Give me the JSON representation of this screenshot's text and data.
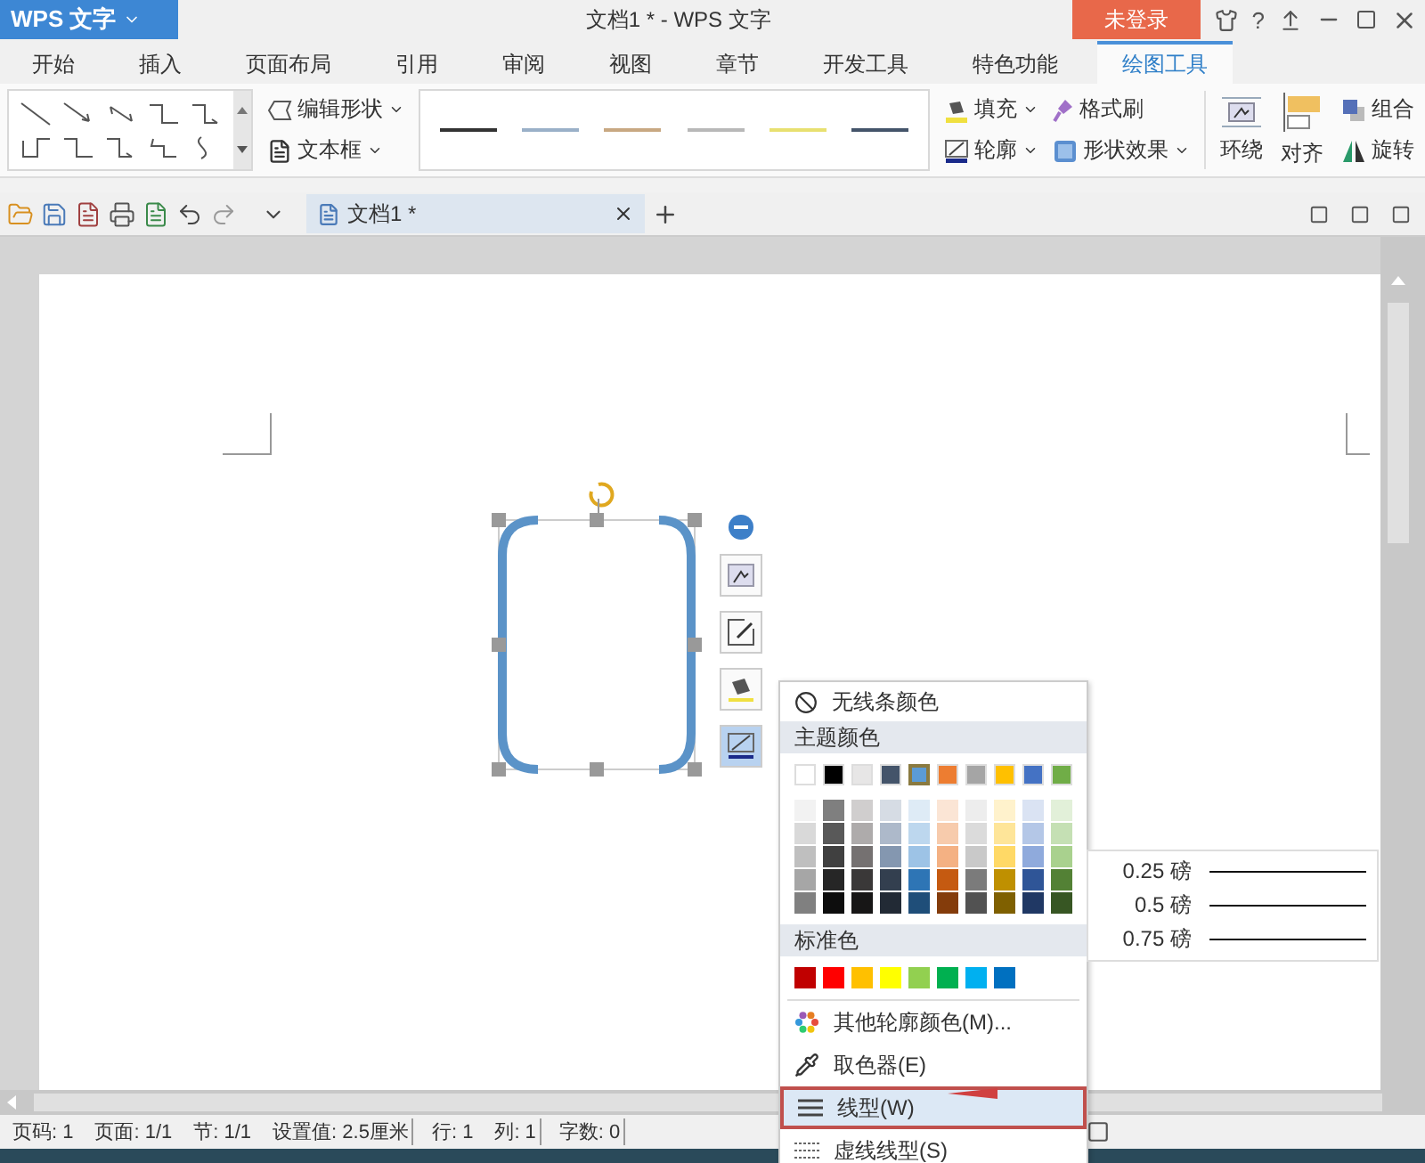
{
  "app_menu": {
    "label": "WPS 文字"
  },
  "window": {
    "title": "文档1 * - WPS 文字"
  },
  "login_button": {
    "label": "未登录"
  },
  "help_button": {
    "label": "?"
  },
  "tabs": [
    {
      "label": "开始",
      "selected": false
    },
    {
      "label": "插入",
      "selected": false
    },
    {
      "label": "页面布局",
      "selected": false
    },
    {
      "label": "引用",
      "selected": false
    },
    {
      "label": "审阅",
      "selected": false
    },
    {
      "label": "视图",
      "selected": false
    },
    {
      "label": "章节",
      "selected": false
    },
    {
      "label": "开发工具",
      "selected": false
    },
    {
      "label": "特色功能",
      "selected": false
    },
    {
      "label": "绘图工具",
      "selected": true
    }
  ],
  "ribbon": {
    "edit_shape": "编辑形状",
    "text_box": "文本框",
    "line_styles": [
      {
        "color": "#333333"
      },
      {
        "color": "#9ab0c8"
      },
      {
        "color": "#c8a882"
      },
      {
        "color": "#b8b8b8"
      },
      {
        "color": "#e8e070"
      },
      {
        "color": "#44546a"
      }
    ],
    "fill": "填充",
    "format_painter": "格式刷",
    "outline": "轮廓",
    "shape_effects": "形状效果",
    "wrap": "环绕",
    "align": "对齐",
    "group": "组合",
    "rotate": "旋转"
  },
  "document_tab": {
    "label": "文档1 *"
  },
  "color_menu": {
    "no_line": "无线条颜色",
    "theme_heading": "主题颜色",
    "theme_colors": [
      {
        "color": "#ffffff",
        "selected": false,
        "shades": [
          {
            "color": "#f2f2f2"
          },
          {
            "color": "#d9d9d9"
          },
          {
            "color": "#bfbfbf"
          },
          {
            "color": "#a6a6a6"
          },
          {
            "color": "#808080"
          }
        ]
      },
      {
        "color": "#000000",
        "selected": false,
        "shades": [
          {
            "color": "#7f7f7f"
          },
          {
            "color": "#595959"
          },
          {
            "color": "#404040"
          },
          {
            "color": "#262626"
          },
          {
            "color": "#0d0d0d"
          }
        ]
      },
      {
        "color": "#e7e6e6",
        "selected": false,
        "shades": [
          {
            "color": "#d0cece"
          },
          {
            "color": "#aeabab"
          },
          {
            "color": "#757171"
          },
          {
            "color": "#3a3838"
          },
          {
            "color": "#171616"
          }
        ]
      },
      {
        "color": "#44546a",
        "selected": false,
        "shades": [
          {
            "color": "#d6dce4"
          },
          {
            "color": "#adb9ca"
          },
          {
            "color": "#8497b0"
          },
          {
            "color": "#333f4f"
          },
          {
            "color": "#222a35"
          }
        ]
      },
      {
        "color": "#5b9bd5",
        "selected": true,
        "shades": [
          {
            "color": "#deebf6"
          },
          {
            "color": "#bdd7ee"
          },
          {
            "color": "#9dc3e6"
          },
          {
            "color": "#2e75b5"
          },
          {
            "color": "#1f4e79"
          }
        ]
      },
      {
        "color": "#ed7d31",
        "selected": false,
        "shades": [
          {
            "color": "#fbe5d5"
          },
          {
            "color": "#f7cbac"
          },
          {
            "color": "#f4b183"
          },
          {
            "color": "#c55a11"
          },
          {
            "color": "#843c0b"
          }
        ]
      },
      {
        "color": "#a5a5a5",
        "selected": false,
        "shades": [
          {
            "color": "#ededed"
          },
          {
            "color": "#dbdbdb"
          },
          {
            "color": "#c9c9c9"
          },
          {
            "color": "#7b7b7b"
          },
          {
            "color": "#525252"
          }
        ]
      },
      {
        "color": "#ffc000",
        "selected": false,
        "shades": [
          {
            "color": "#fff2cc"
          },
          {
            "color": "#fee599"
          },
          {
            "color": "#ffd966"
          },
          {
            "color": "#bf9000"
          },
          {
            "color": "#7f6000"
          }
        ]
      },
      {
        "color": "#4472c4",
        "selected": false,
        "shades": [
          {
            "color": "#dae3f3"
          },
          {
            "color": "#b4c7e7"
          },
          {
            "color": "#8faadc"
          },
          {
            "color": "#2f5597"
          },
          {
            "color": "#203864"
          }
        ]
      },
      {
        "color": "#70ad47",
        "selected": false,
        "shades": [
          {
            "color": "#e2f0d9"
          },
          {
            "color": "#c5e0b4"
          },
          {
            "color": "#a9d18e"
          },
          {
            "color": "#538135"
          },
          {
            "color": "#375623"
          }
        ]
      }
    ],
    "standard_heading": "标准色",
    "standard_colors": [
      {
        "color": "#c00000"
      },
      {
        "color": "#ff0000"
      },
      {
        "color": "#ffc000"
      },
      {
        "color": "#ffff00"
      },
      {
        "color": "#92d050"
      },
      {
        "color": "#00b050"
      },
      {
        "color": "#00b0f0"
      },
      {
        "color": "#0070c0"
      }
    ],
    "items": [
      {
        "kind": "more",
        "label": "其他轮廓颜色(M)...",
        "selected": false
      },
      {
        "kind": "picker",
        "label": "取色器(E)",
        "selected": false
      },
      {
        "kind": "line",
        "label": "线型(W)",
        "selected": true
      },
      {
        "kind": "dash",
        "label": "虚线线型(S)",
        "selected": false
      }
    ]
  },
  "line_weight_menu": [
    {
      "label": "0.25 磅"
    },
    {
      "label": "0.5 磅"
    },
    {
      "label": "0.75 磅"
    }
  ],
  "status_bar": [
    {
      "label": "页码: 1",
      "divider": false
    },
    {
      "label": "页面: 1/1",
      "divider": false
    },
    {
      "label": "节: 1/1",
      "divider": false
    },
    {
      "label": "设置值: 2.5厘米",
      "divider": true
    },
    {
      "label": "行: 1",
      "divider": false
    },
    {
      "label": "列: 1",
      "divider": true
    },
    {
      "label": "字数: 0",
      "divider": true
    }
  ]
}
